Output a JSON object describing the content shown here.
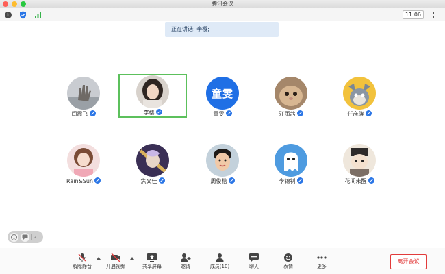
{
  "window": {
    "title": "腾讯会议"
  },
  "topbar": {
    "time": "11:06"
  },
  "banner": {
    "text": "正在讲话: 李樱;"
  },
  "participants": [
    {
      "name": "闫霞飞",
      "avatar": "photo-hand"
    },
    {
      "name": "李樱",
      "avatar": "photo-girl",
      "active": true
    },
    {
      "name": "童雯",
      "avatar": "text-avatar",
      "avatar_text": "童雯"
    },
    {
      "name": "汪雨茜",
      "avatar": "photo-cat"
    },
    {
      "name": "任彦骁",
      "avatar": "cartoon-tom"
    },
    {
      "name": "Rain&Sun",
      "avatar": "photo-girl-pink"
    },
    {
      "name": "焦文佳",
      "avatar": "anime-character"
    },
    {
      "name": "周俊楷",
      "avatar": "photo-boy"
    },
    {
      "name": "李锦钊",
      "avatar": "cartoon-ghost"
    },
    {
      "name": "花间未醒",
      "avatar": "anime-robot"
    }
  ],
  "toolbar": {
    "unmute": "解除静音",
    "start_video": "开启视频",
    "share_screen": "共享屏幕",
    "invite": "邀请",
    "members": "成员(10)",
    "chat": "聊天",
    "reactions": "表情",
    "more": "更多",
    "leave": "离开会议"
  },
  "colors": {
    "accent": "#2b76e6",
    "active_border": "#5cc05c",
    "leave": "#e23b3b"
  }
}
